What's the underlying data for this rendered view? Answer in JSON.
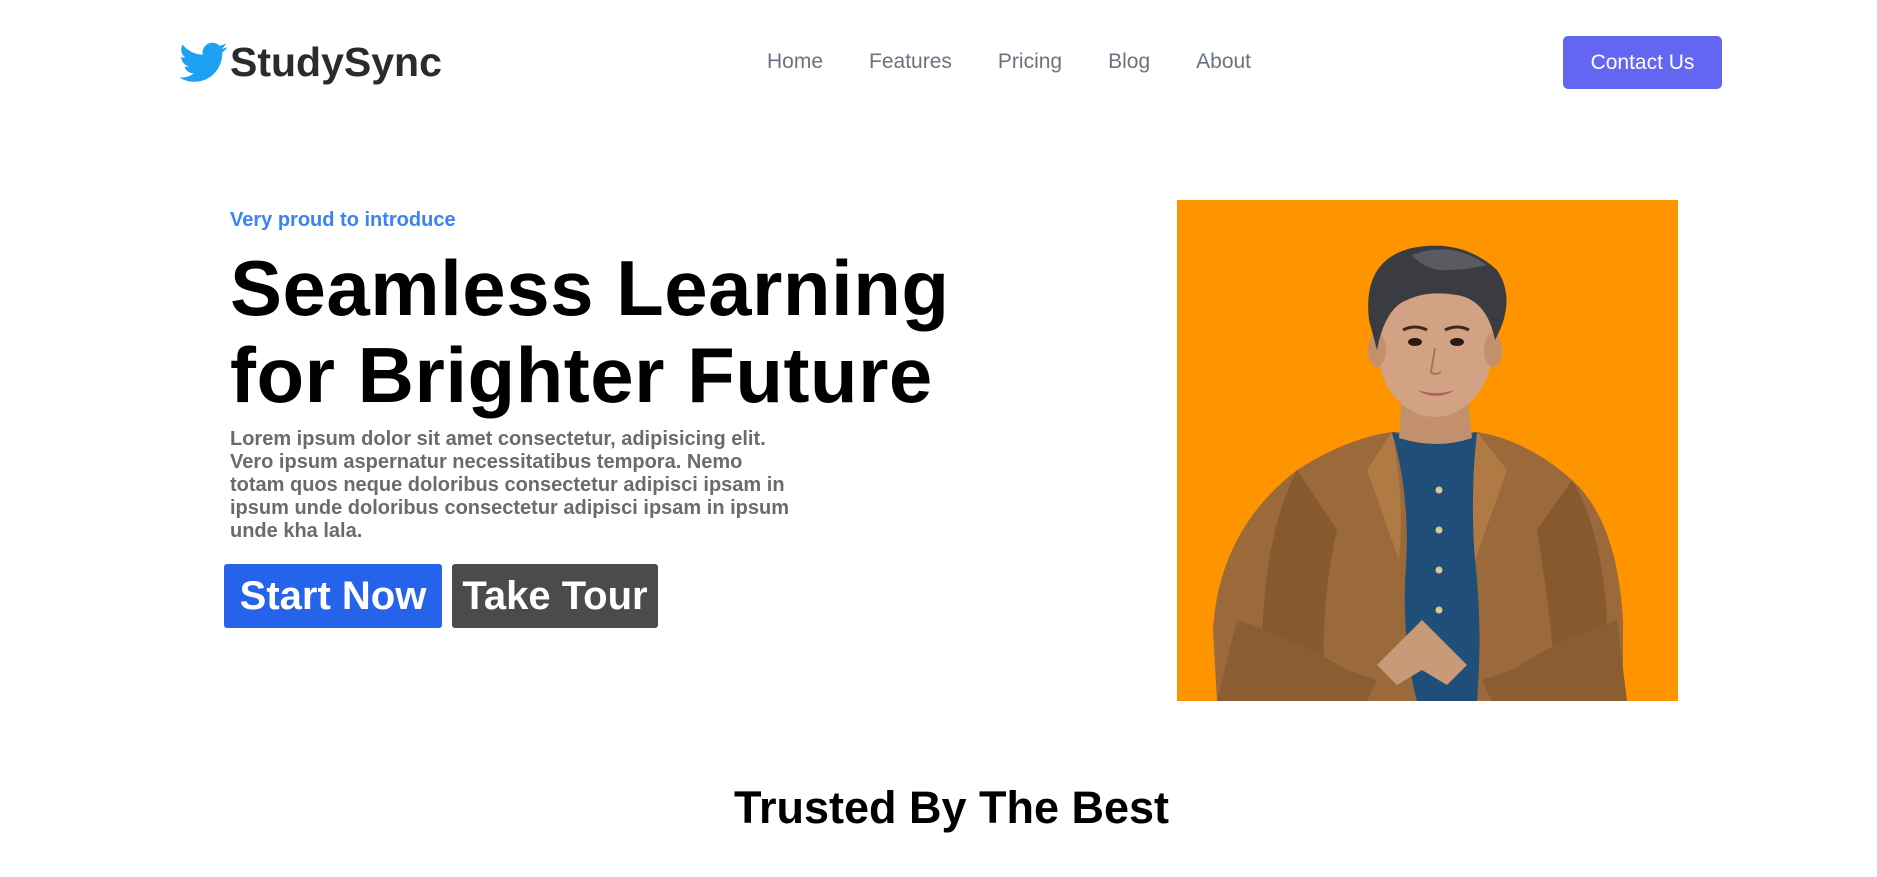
{
  "header": {
    "brand_name": "StudySync",
    "brand_icon": "twitter-bird-icon",
    "nav": [
      {
        "label": "Home"
      },
      {
        "label": "Features"
      },
      {
        "label": "Pricing"
      },
      {
        "label": "Blog"
      },
      {
        "label": "About"
      }
    ],
    "contact_label": "Contact Us"
  },
  "hero": {
    "eyebrow": "Very proud to introduce",
    "title_line1": "Seamless Learning",
    "title_line2": "for Brighter Future",
    "description": "Lorem ipsum dolor sit amet consectetur, adipisicing elit. Vero ipsum aspernatur necessitatibus tempora. Nemo totam quos neque doloribus consectetur adipisci ipsam in ipsum unde doloribus consectetur adipisci ipsam in ipsum unde kha lala.",
    "start_label": "Start Now",
    "tour_label": "Take Tour"
  },
  "trusted": {
    "heading": "Trusted By The Best"
  },
  "colors": {
    "accent": "#6366f1",
    "eyebrow": "#3b82f6",
    "start_button": "#2563eb",
    "tour_button": "#4b4b4b",
    "image_background": "#fe9500"
  }
}
